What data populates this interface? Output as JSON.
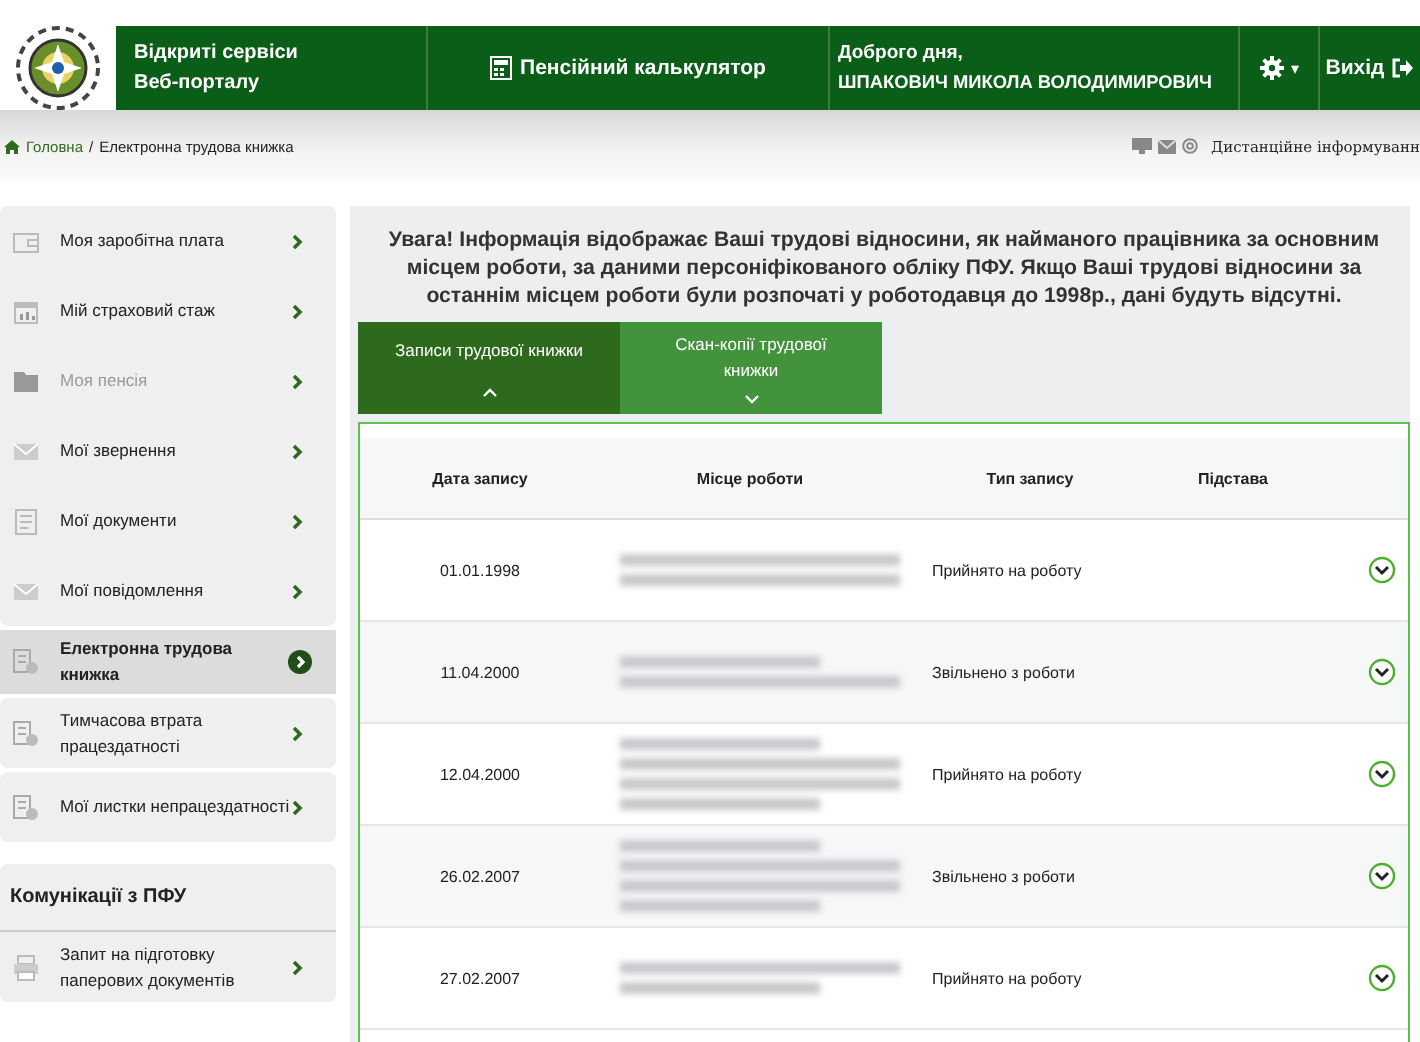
{
  "header": {
    "site_title": [
      "Відкриті сервіси",
      "Веб-порталу"
    ],
    "calculator": "Пенсійний калькулятор",
    "greeting": "Доброго дня,",
    "user_name": "ШПАКОВИЧ МИКОЛА ВОЛОДИМИРОВИЧ",
    "caret": "▾",
    "logout": "Вихід"
  },
  "breadcrumb": {
    "home": "Головна",
    "separator": "/",
    "current": "Електронна трудова книжка",
    "remote_info": "Дистанційне інформуванн"
  },
  "sidebar": {
    "groups": [
      {
        "items": [
          {
            "label": "Моя заробітна плата",
            "disabled": false,
            "selected": false
          },
          {
            "label": "Мій страховий стаж",
            "disabled": false,
            "selected": false
          },
          {
            "label": "Моя пенсія",
            "disabled": true,
            "selected": false
          },
          {
            "label": "Мої звернення",
            "disabled": false,
            "selected": false
          },
          {
            "label": "Мої документи",
            "disabled": false,
            "selected": false
          },
          {
            "label": "Мої повідомлення",
            "disabled": false,
            "selected": false
          }
        ]
      },
      {
        "items": [
          {
            "label": "Електронна трудова книжка",
            "disabled": false,
            "selected": true
          }
        ]
      },
      {
        "items": [
          {
            "label": "Тимчасова втрата працездатності",
            "disabled": false,
            "selected": false
          }
        ]
      },
      {
        "items": [
          {
            "label": "Мої листки непрацездатності",
            "disabled": false,
            "selected": false
          }
        ]
      }
    ],
    "section": {
      "title": "Комунікації з ПФУ",
      "items": [
        {
          "label": "Запит на підготовку паперових документів",
          "disabled": false,
          "selected": false
        }
      ]
    }
  },
  "notice": "Увага! Інформація відображає Ваші трудові відносини, як найманого працівника за основним місцем роботи, за даними персоніфікованого обліку ПФУ. Якщо Ваші трудові відносини за останнім місцем роботи були розпочаті у роботодавця до 1998р., дані будуть відсутні.",
  "tabs": [
    {
      "label": "Записи трудової книжки",
      "selected": true,
      "expanded": true
    },
    {
      "label": "Скан-копії трудової книжки",
      "selected": false,
      "expanded": false
    }
  ],
  "table": {
    "columns": [
      "Дата запису",
      "Місце роботи",
      "Тип запису",
      "Підстава"
    ],
    "rows": [
      {
        "date": "01.01.1998",
        "type": "Прийнято на роботу"
      },
      {
        "date": "11.04.2000",
        "type": "Звільнено з роботи"
      },
      {
        "date": "12.04.2000",
        "type": "Прийнято на роботу"
      },
      {
        "date": "26.02.2007",
        "type": "Звільнено з роботи"
      },
      {
        "date": "27.02.2007",
        "type": "Прийнято на роботу"
      }
    ]
  }
}
